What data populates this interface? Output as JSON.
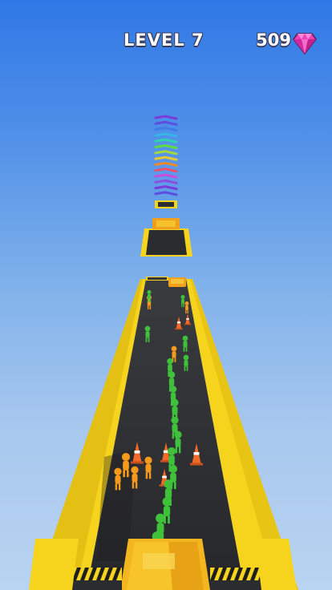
{
  "hud": {
    "level_label": "LEVEL 7",
    "gem_count": "509",
    "gem_icon": "pink-diamond-icon"
  },
  "colors": {
    "rail_yellow": "#f6d31c",
    "road_dark": "#2b2c2f",
    "runner_green": "#3fc23a",
    "runner_orange": "#f59a1c",
    "cone_orange": "#f26a2a",
    "gem_pink": "#f23fb8"
  }
}
